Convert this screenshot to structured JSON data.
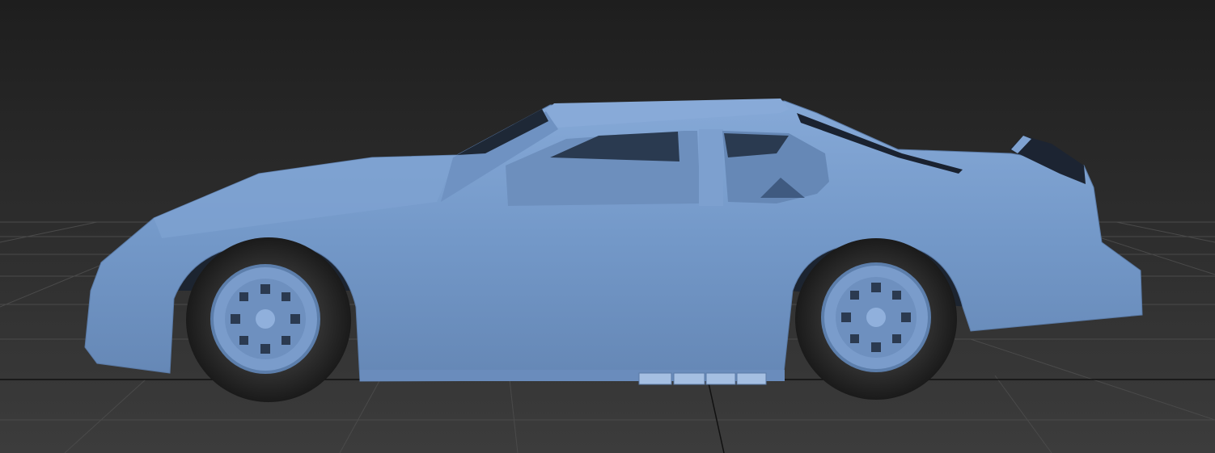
{
  "viewport": {
    "colors": {
      "background_top": "#1e1e1e",
      "background_bottom": "#3c3c3c",
      "grid": "#4a4a4a",
      "grid_axis": "#111111",
      "body": "#7196c6",
      "body_light": "#85a8d6",
      "body_dark": "#4f6f99",
      "tire": "#2a2a2a",
      "rim": "#7a9ccb",
      "interior": "#6a8cba"
    }
  }
}
